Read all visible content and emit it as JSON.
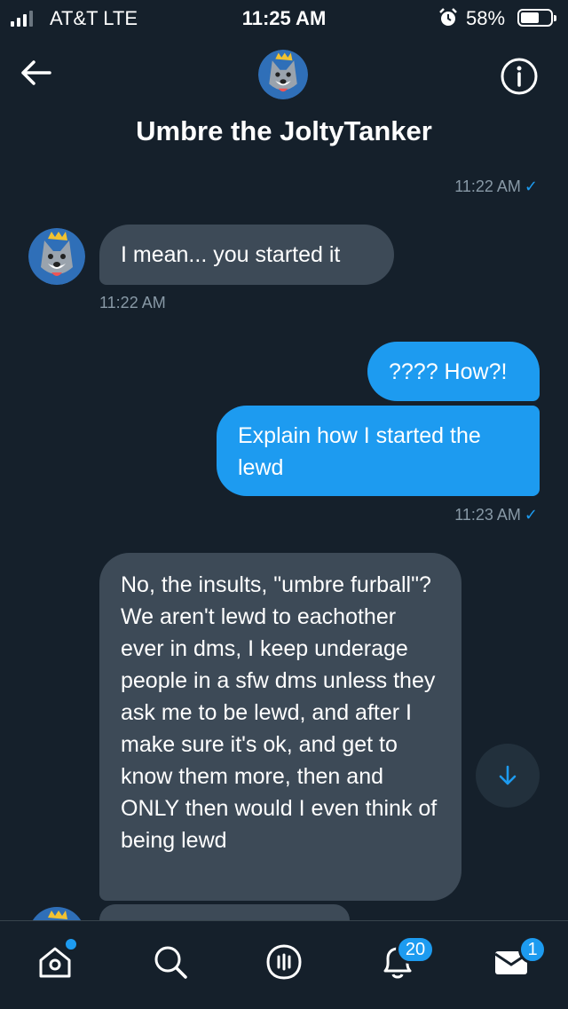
{
  "status_bar": {
    "carrier": "AT&T  LTE",
    "time": "11:25 AM",
    "battery": "58%"
  },
  "header": {
    "title": "Umbre the JoltyTanker"
  },
  "messages": [
    {
      "side": "out",
      "timestamp": "11:22 AM",
      "read": "✓"
    },
    {
      "side": "in",
      "text": "I mean... you started it",
      "timestamp": "11:22 AM"
    },
    {
      "side": "out",
      "text": "???? How?!"
    },
    {
      "side": "out",
      "text": "Explain how I started the lewd",
      "timestamp": "11:23 AM",
      "read": "✓"
    },
    {
      "side": "in",
      "text": "No, the insults, \"umbre furball\"? We aren't lewd to eachother ever in dms, I keep underage people in a sfw dms unless they ask me to be lewd, and after I make sure it's ok, and get to know them more, then and ONLY then would I even think of being lewd"
    }
  ],
  "tabbar": {
    "items": [
      {
        "name": "home",
        "icon": "home-icon",
        "badge": ""
      },
      {
        "name": "search",
        "icon": "search-icon",
        "badge": ""
      },
      {
        "name": "spaces",
        "icon": "spaces-icon",
        "badge": ""
      },
      {
        "name": "notifications",
        "icon": "bell-icon",
        "badge": "20"
      },
      {
        "name": "messages",
        "icon": "mail-icon",
        "badge": "1"
      }
    ]
  },
  "colors": {
    "background": "#15202b",
    "accent": "#1d9bf0",
    "incoming_bubble": "#3d4a57"
  }
}
